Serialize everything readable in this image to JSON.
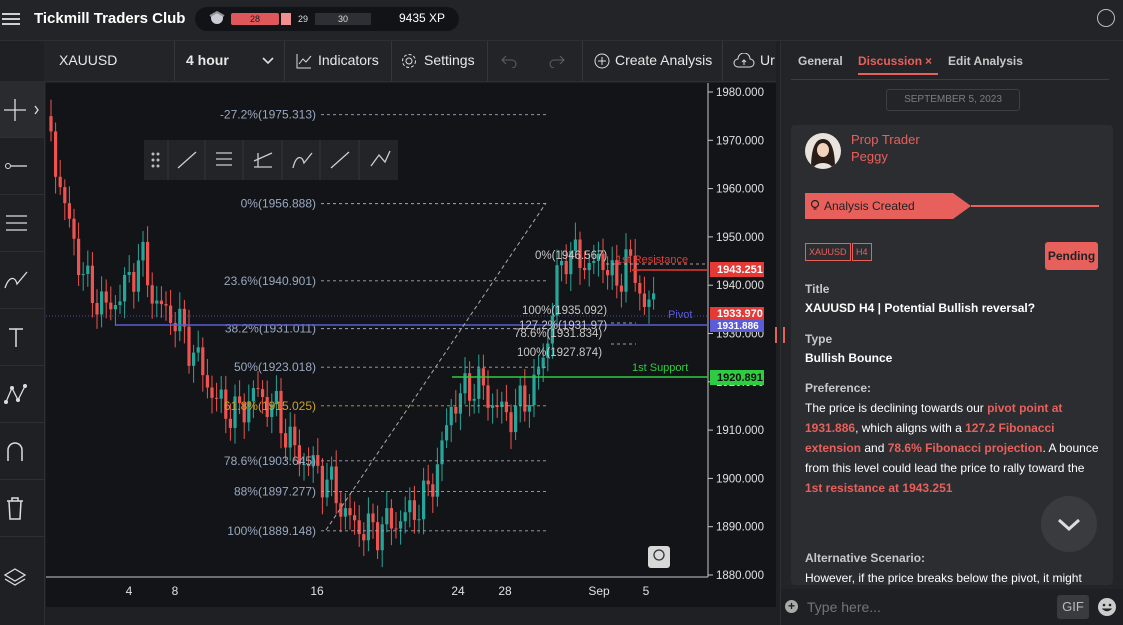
{
  "app": {
    "title": "Tickmill Traders Club"
  },
  "xp": {
    "seg1": "28",
    "seg2": "29",
    "seg3": "30",
    "total": "9435 XP"
  },
  "toolbar": {
    "symbol": "XAUUSD",
    "timeframe": "4 hour",
    "indicators": "Indicators",
    "settings": "Settings",
    "create_analysis": "Create Analysis",
    "upload": "Ur"
  },
  "chart": {
    "y_ticks": [
      "1980.000",
      "1970.000",
      "1960.000",
      "1950.000",
      "1940.000",
      "1930.000",
      "1920.000",
      "1910.000",
      "1900.000",
      "1890.000",
      "1880.000"
    ],
    "x_ticks": [
      "4",
      "8",
      "16",
      "24",
      "28",
      "Sep",
      "5"
    ],
    "fib_retracement": [
      "-27.2%(1975.313)",
      "0%(1956.888)",
      "23.6%(1940.901)",
      "38.2%(1931.011)",
      "50%(1923.018)",
      "61.8%(1915.025)",
      "78.6%(1903.645)",
      "88%(1897.277)",
      "100%(1889.148)"
    ],
    "fib_projection": [
      "0%(1946.567)",
      "100%(1935.092)",
      "127.2%(1931.97)",
      "78.6%(1931.834)",
      "100%(1927.874)"
    ],
    "labels": {
      "resistance": "1st Resistance",
      "pivot": "Pivot",
      "support": "1st Support"
    },
    "price_tags": {
      "resistance": "1943.251",
      "current": "1933.970",
      "pivot": "1931.886",
      "support": "1920.891"
    },
    "colors": {
      "up": "#26a69a",
      "down": "#ef5350",
      "resistance": "#e53935",
      "support": "#2ecc40",
      "pivot": "#5a5cd8"
    }
  },
  "panel": {
    "tabs": {
      "general": "General",
      "discussion": "Discussion",
      "edit": "Edit Analysis"
    },
    "date": "SEPTEMBER 5, 2023",
    "author_role": "Prop Trader",
    "author_name": "Peggy",
    "event": "Analysis Created",
    "tags": [
      "XAUUSD",
      "H4"
    ],
    "status": "Pending",
    "title_label": "Title",
    "title_value": "XAUUSD H4 | Potential Bullish reversal?",
    "type_label": "Type",
    "type_value": "Bullish Bounce",
    "pref_label": "Preference:",
    "pref": {
      "t1": "The price is declining towards our ",
      "h1": "pivot point at 1931.886",
      "t2": ", which aligns with a ",
      "h2": "127.2 Fibonacci extension",
      "t3": " and ",
      "h3": "78.6% Fibonacci projection",
      "t4": ". A bounce from this level could lead the price to rally toward the ",
      "h4": "1st resistance at 1943.251"
    },
    "alt_label": "Alternative Scenario:",
    "alt_text": "However, if the price breaks below the pivot, it might",
    "composer_placeholder": "Type here...",
    "gif": "GIF"
  }
}
